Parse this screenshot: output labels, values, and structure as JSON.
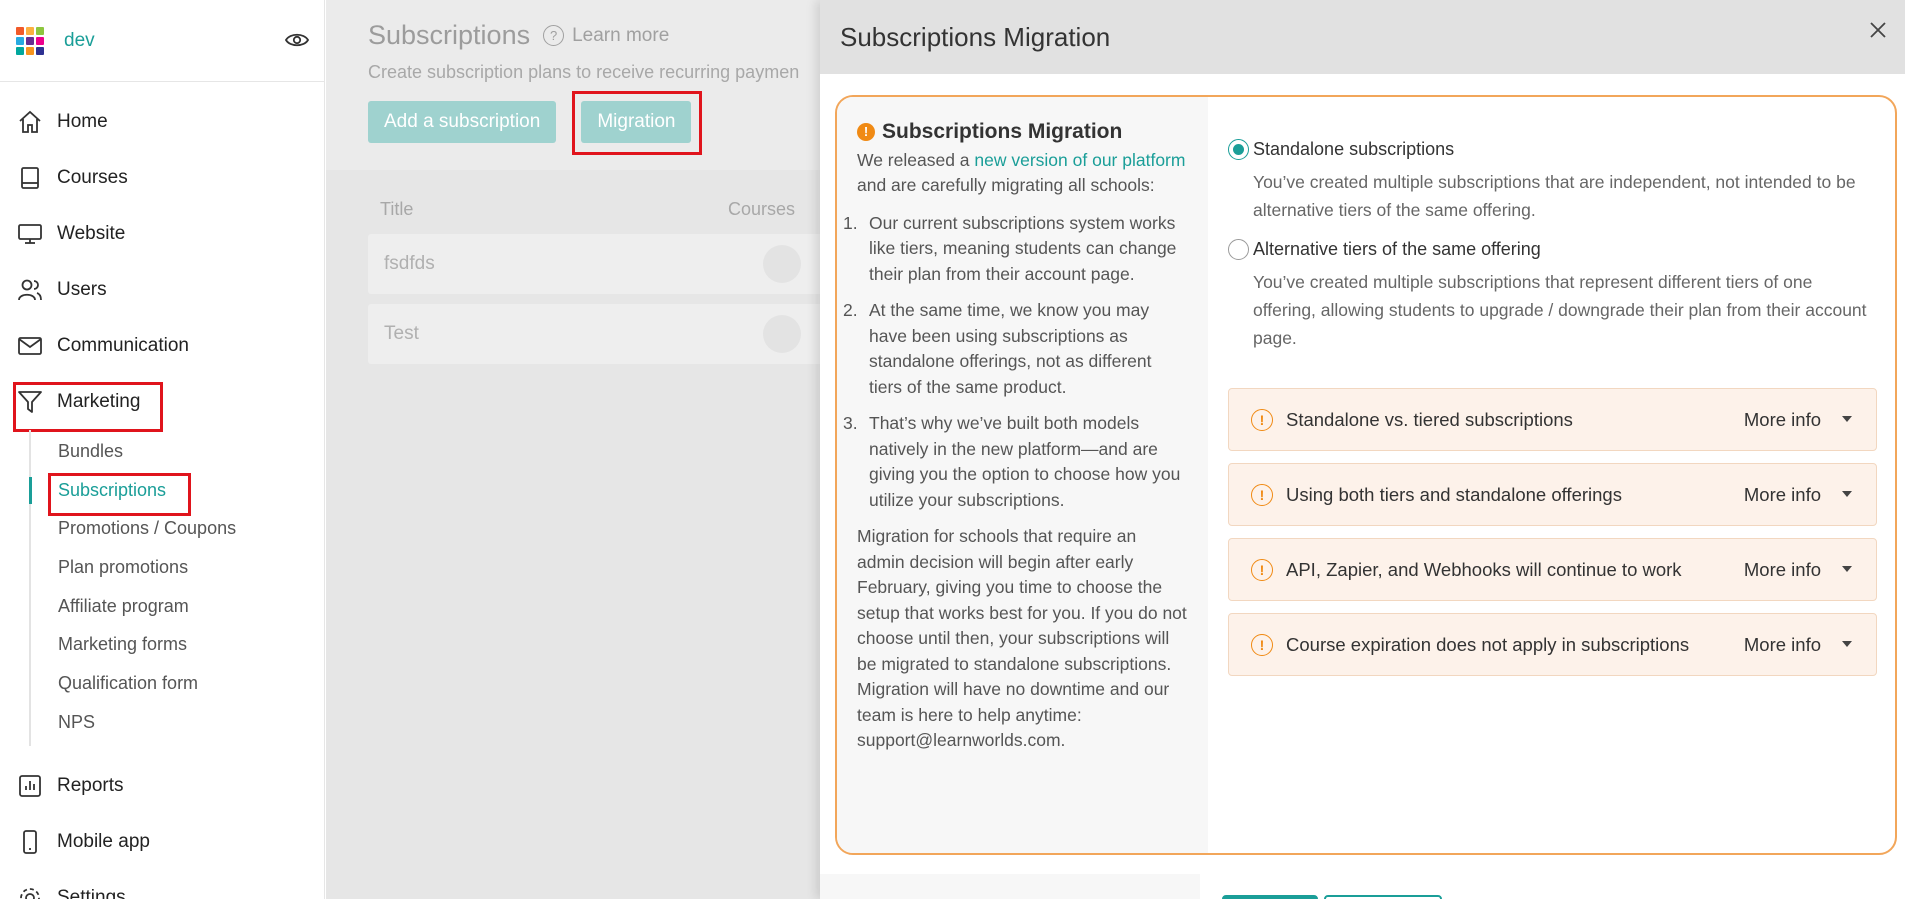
{
  "sidebar": {
    "brand": "dev",
    "logo_colors": [
      "#f15a29",
      "#fbb040",
      "#8dc63f",
      "#27aae1",
      "#662d91",
      "#ec008c",
      "#00a79d",
      "#f7941e",
      "#2e3192"
    ],
    "nav_top": [
      {
        "label": "Home",
        "icon": "home-icon"
      },
      {
        "label": "Courses",
        "icon": "book-icon"
      },
      {
        "label": "Website",
        "icon": "monitor-icon"
      },
      {
        "label": "Users",
        "icon": "users-icon"
      },
      {
        "label": "Communication",
        "icon": "mail-icon"
      },
      {
        "label": "Marketing",
        "icon": "funnel-icon"
      }
    ],
    "marketing_sub": [
      "Bundles",
      "Subscriptions",
      "Promotions / Coupons",
      "Plan promotions",
      "Affiliate program",
      "Marketing forms",
      "Qualification form",
      "NPS"
    ],
    "nav_bottom": [
      {
        "label": "Reports",
        "icon": "chart-icon"
      },
      {
        "label": "Mobile app",
        "icon": "phone-icon"
      },
      {
        "label": "Settings",
        "icon": "gear-icon"
      }
    ]
  },
  "main": {
    "title": "Subscriptions",
    "learn_more": "Learn more",
    "subtitle": "Create subscription plans to receive recurring paymen",
    "add_button": "Add a subscription",
    "migration_button": "Migration",
    "columns": [
      "Title",
      "Courses"
    ],
    "rows": [
      "fsdfds",
      "Test"
    ]
  },
  "modal": {
    "title": "Subscriptions Migration",
    "left": {
      "heading": "Subscriptions Migration",
      "intro_pre": "We released a ",
      "intro_link": "new version of our platform",
      "intro_post": " and are carefully migrating all schools:",
      "items": [
        "Our current subscriptions system works like tiers, meaning students can change their plan from their account page.",
        "At the same time, we know you may have been using subscriptions as standalone offerings, not as different tiers of the same product.",
        "That’s why we’ve built both models natively in the new platform—and are giving you the option to choose how you utilize your subscriptions."
      ],
      "closing": "Migration for schools that require an admin decision will begin after early February, giving you time to choose the setup that works best for you. If you do not choose until then, your subscriptions will be migrated to standalone subscriptions. Migration will have no downtime and our team is here to help anytime: support@learnworlds.com."
    },
    "options": [
      {
        "label": "Standalone subscriptions",
        "selected": true,
        "desc": "You’ve created multiple subscriptions that are independent, not intended to be alternative tiers of the same offering."
      },
      {
        "label": "Alternative tiers of the same offering",
        "selected": false,
        "desc": "You’ve created multiple subscriptions that represent different tiers of one offering, allowing students to upgrade / downgrade their plan from their account page."
      }
    ],
    "accordions": [
      {
        "label": "Standalone vs. tiered subscriptions",
        "more": "More info"
      },
      {
        "label": "Using both tiers and standalone offerings",
        "more": "More info"
      },
      {
        "label": "API, Zapier, and Webhooks will continue to work",
        "more": "More info"
      },
      {
        "label": "Course expiration does not apply in subscriptions",
        "more": "More info"
      }
    ]
  },
  "colors": {
    "accent": "#1a9e98",
    "warning": "#f08a14",
    "highlight": "#e0141c"
  }
}
